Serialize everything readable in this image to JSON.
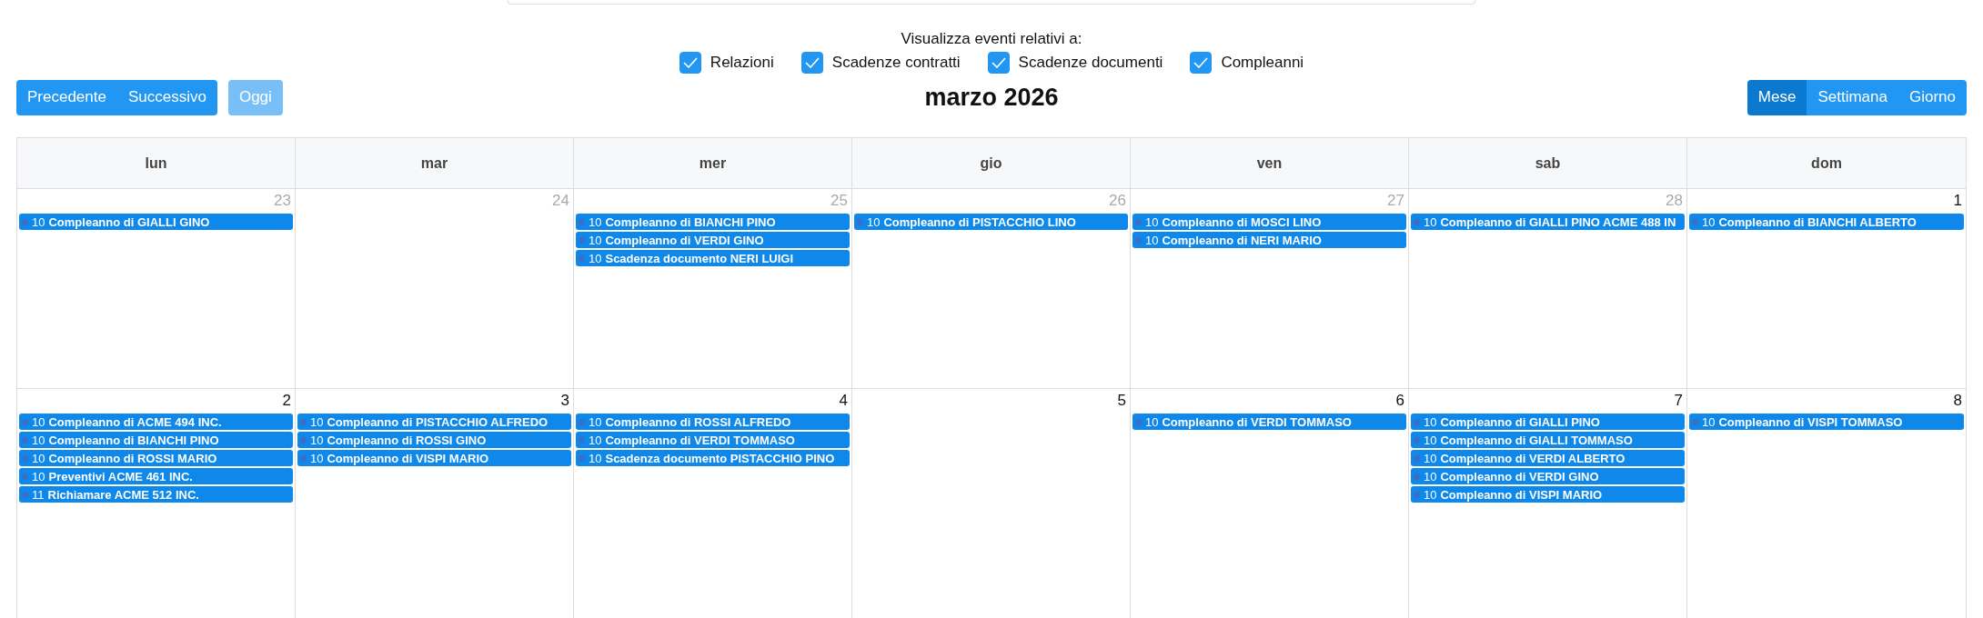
{
  "filters": {
    "label": "Visualizza eventi relativi a:",
    "options": [
      {
        "label": "Relazioni",
        "checked": true
      },
      {
        "label": "Scadenze contratti",
        "checked": true
      },
      {
        "label": "Scadenze documenti",
        "checked": true
      },
      {
        "label": "Compleanni",
        "checked": true
      }
    ]
  },
  "toolbar": {
    "nav_buttons": [
      {
        "label": "Precedente",
        "disabled": false
      },
      {
        "label": "Successivo",
        "disabled": false
      }
    ],
    "today_button": {
      "label": "Oggi",
      "disabled": true
    },
    "title": "marzo 2026",
    "views": [
      {
        "label": "Mese",
        "selected": true
      },
      {
        "label": "Settimana",
        "selected": false
      },
      {
        "label": "Giorno",
        "selected": false
      }
    ]
  },
  "calendar": {
    "weekdays": [
      "lun",
      "mar",
      "mer",
      "gio",
      "ven",
      "sab",
      "dom"
    ],
    "weeks": [
      [
        {
          "day": "23",
          "other_month": true,
          "events": [
            {
              "time": "10",
              "title": "Compleanno di GIALLI GINO"
            }
          ]
        },
        {
          "day": "24",
          "other_month": true
        },
        {
          "day": "25",
          "other_month": true,
          "events": [
            {
              "time": "10",
              "title": "Compleanno di BIANCHI PINO"
            },
            {
              "time": "10",
              "title": "Compleanno di VERDI GINO"
            },
            {
              "time": "10",
              "title": "Scadenza documento NERI LUIGI"
            }
          ]
        },
        {
          "day": "26",
          "other_month": true,
          "events": [
            {
              "time": "10",
              "title": "Compleanno di PISTACCHIO LINO"
            }
          ]
        },
        {
          "day": "27",
          "other_month": true,
          "events": [
            {
              "time": "10",
              "title": "Compleanno di MOSCI LINO"
            },
            {
              "time": "10",
              "title": "Compleanno di NERI MARIO"
            }
          ]
        },
        {
          "day": "28",
          "other_month": true,
          "events": [
            {
              "time": "10",
              "title": "Compleanno di GIALLI PINO ACME 488 IN"
            }
          ]
        },
        {
          "day": "1",
          "other_month": false,
          "events": [
            {
              "time": "10",
              "title": "Compleanno di BIANCHI ALBERTO"
            }
          ]
        }
      ],
      [
        {
          "day": "2",
          "other_month": false,
          "events": [
            {
              "time": "10",
              "title": "Compleanno di ACME 494 INC."
            },
            {
              "time": "10",
              "title": "Compleanno di BIANCHI PINO"
            },
            {
              "time": "10",
              "title": "Compleanno di ROSSI MARIO"
            },
            {
              "time": "10",
              "title": "Preventivi ACME 461 INC."
            },
            {
              "time": "11",
              "title": "Richiamare ACME 512 INC."
            }
          ]
        },
        {
          "day": "3",
          "other_month": false,
          "events": [
            {
              "time": "10",
              "title": "Compleanno di PISTACCHIO ALFREDO"
            },
            {
              "time": "10",
              "title": "Compleanno di ROSSI GINO"
            },
            {
              "time": "10",
              "title": "Compleanno di VISPI MARIO"
            }
          ]
        },
        {
          "day": "4",
          "other_month": false,
          "events": [
            {
              "time": "10",
              "title": "Compleanno di ROSSI ALFREDO"
            },
            {
              "time": "10",
              "title": "Compleanno di VERDI TOMMASO"
            },
            {
              "time": "10",
              "title": "Scadenza documento PISTACCHIO PINO"
            }
          ]
        },
        {
          "day": "5",
          "other_month": false
        },
        {
          "day": "6",
          "other_month": false,
          "events": [
            {
              "time": "10",
              "title": "Compleanno di VERDI TOMMASO"
            }
          ]
        },
        {
          "day": "7",
          "other_month": false,
          "events": [
            {
              "time": "10",
              "title": "Compleanno di GIALLI PINO"
            },
            {
              "time": "10",
              "title": "Compleanno di GIALLI TOMMASO"
            },
            {
              "time": "10",
              "title": "Compleanno di VERDI ALBERTO"
            },
            {
              "time": "10",
              "title": "Compleanno di VERDI GINO"
            },
            {
              "time": "10",
              "title": "Compleanno di VISPI MARIO"
            }
          ]
        },
        {
          "day": "8",
          "other_month": false,
          "events": [
            {
              "time": "10",
              "title": "Compleanno di VISPI TOMMASO"
            }
          ]
        }
      ]
    ]
  }
}
